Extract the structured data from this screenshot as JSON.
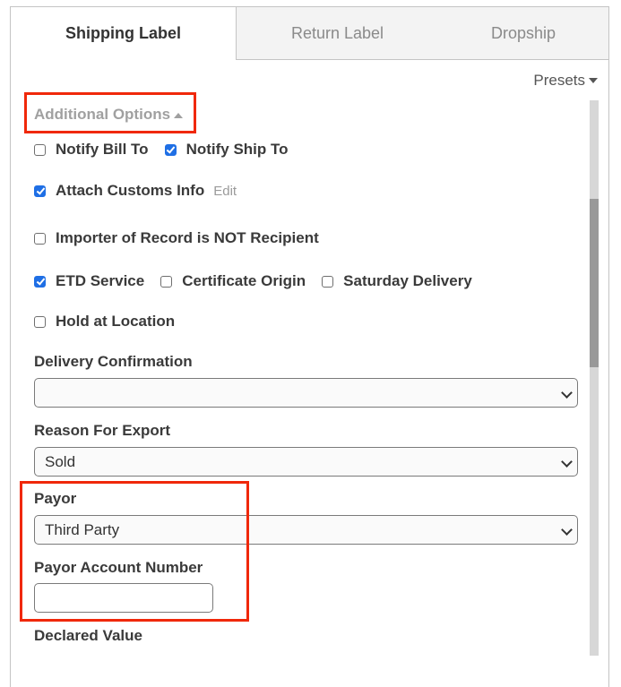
{
  "tabs": [
    {
      "label": "Shipping Label",
      "active": true
    },
    {
      "label": "Return Label",
      "active": false
    },
    {
      "label": "Dropship",
      "active": false
    }
  ],
  "presets_label": "Presets",
  "additional_options": {
    "label": "Additional Options",
    "expanded": true
  },
  "checkboxes": {
    "notify_bill_to": {
      "label": "Notify Bill To",
      "checked": false
    },
    "notify_ship_to": {
      "label": "Notify Ship To",
      "checked": true
    },
    "attach_customs_info": {
      "label": "Attach Customs Info",
      "checked": true,
      "edit_label": "Edit"
    },
    "importer_of_record": {
      "label": "Importer of Record is NOT Recipient",
      "checked": false
    },
    "etd_service": {
      "label": "ETD Service",
      "checked": true
    },
    "certificate_origin": {
      "label": "Certificate Origin",
      "checked": false
    },
    "saturday_delivery": {
      "label": "Saturday Delivery",
      "checked": false
    },
    "hold_at_location": {
      "label": "Hold at Location",
      "checked": false
    }
  },
  "fields": {
    "delivery_confirmation": {
      "label": "Delivery Confirmation",
      "value": ""
    },
    "reason_for_export": {
      "label": "Reason For Export",
      "value": "Sold"
    },
    "payor": {
      "label": "Payor",
      "value": "Third Party"
    },
    "payor_account_number": {
      "label": "Payor Account Number",
      "value": ""
    },
    "declared_value": {
      "label": "Declared Value"
    }
  },
  "colors": {
    "highlight": "#f0280a",
    "checkbox_checked": "#1f6fe5"
  }
}
